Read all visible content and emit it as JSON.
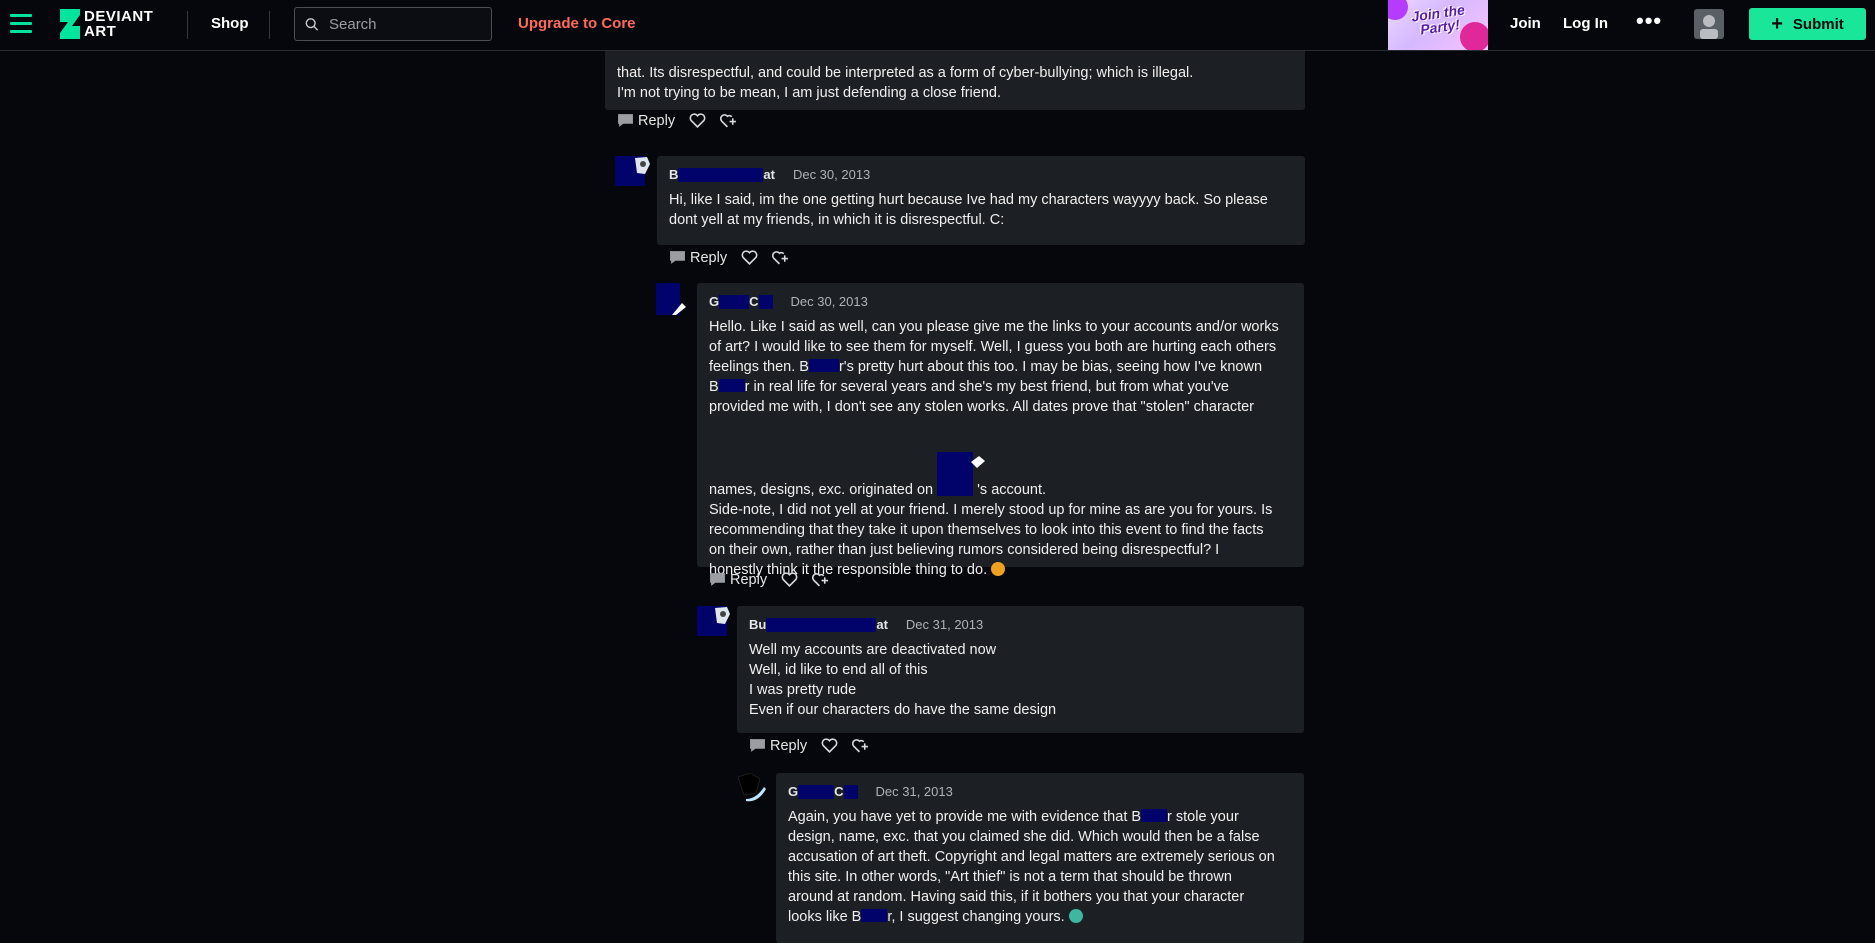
{
  "header": {
    "logo_text": "DEVIANT ART",
    "shop_label": "Shop",
    "search_placeholder": "Search",
    "upgrade_label": "Upgrade to Core",
    "promo_text": "Join the Party!",
    "join_label": "Join",
    "login_label": "Log In",
    "more_label": "•••",
    "submit_label": "Submit",
    "accent_color": "#00e59b",
    "upgrade_color": "#ff6b5b"
  },
  "comments": [
    {
      "lines": [
        "that. Its disrespectful, and could be interpreted as a form of cyber-bullying; which is illegal.",
        "I'm not trying to be mean, I am just defending a close friend."
      ],
      "reply_label": "Reply"
    },
    {
      "user_first": "B",
      "user_last": "at",
      "date": "Dec 30, 2013",
      "lines": [
        "Hi, like I said, im the one getting hurt because Ive had my characters wayyyy back. So please",
        "dont yell at my friends, in which it is disrespectful. C:"
      ],
      "reply_label": "Reply"
    },
    {
      "user_first": "G",
      "user_last": "C",
      "date": "Dec 30, 2013",
      "l1": "Hello. Like I said as well, can you please give me the links to your accounts and/or works",
      "l2": "of art? I would like to see them for myself. Well, I guess you both are hurting each others",
      "l3a": "feelings then. B",
      "l3b": "r's pretty hurt about this too. I may be bias, seeing how I've known",
      "l4a": "B",
      "l4b": "r in real life for several years and she's my best friend, but from what you've",
      "l5": "provided me with, I don't see any stolen works. All dates prove that \"stolen\" character",
      "l6a": "names, designs, exc. originated on",
      "l6b": "'s account.",
      "l7": "Side-note, I did not yell at your friend. I merely stood up for mine as are you for yours. Is",
      "l8": "recommending that they take it upon themselves to look into this event to find the facts",
      "l9": "on their own, rather than just believing rumors considered being disrespectful? I",
      "l10": "honestly think it the responsible thing to do.",
      "reply_label": "Reply"
    },
    {
      "user_first": "Bu",
      "user_last": "at",
      "date": "Dec 31, 2013",
      "lines": [
        "Well my accounts are deactivated now",
        "Well, id like to end all of this",
        "I was pretty rude",
        "Even if our characters do have the same design"
      ],
      "reply_label": "Reply"
    },
    {
      "user_first": "G",
      "user_last": "C",
      "date": "Dec 31, 2013",
      "l1a": "Again, you have yet to provide me with evidence that B",
      "l1b": "r stole your",
      "l2": "design, name, exc. that you claimed she did. Which would then be a false",
      "l3": "accusation of art theft. Copyright and legal matters are extremely serious on",
      "l4": "this site. In other words, \"Art thief\" is not a term that should be thrown",
      "l5": "around at random. Having said this, if it bothers you that your character",
      "l6a": "looks like B",
      "l6b": "r, I suggest changing yours."
    }
  ]
}
